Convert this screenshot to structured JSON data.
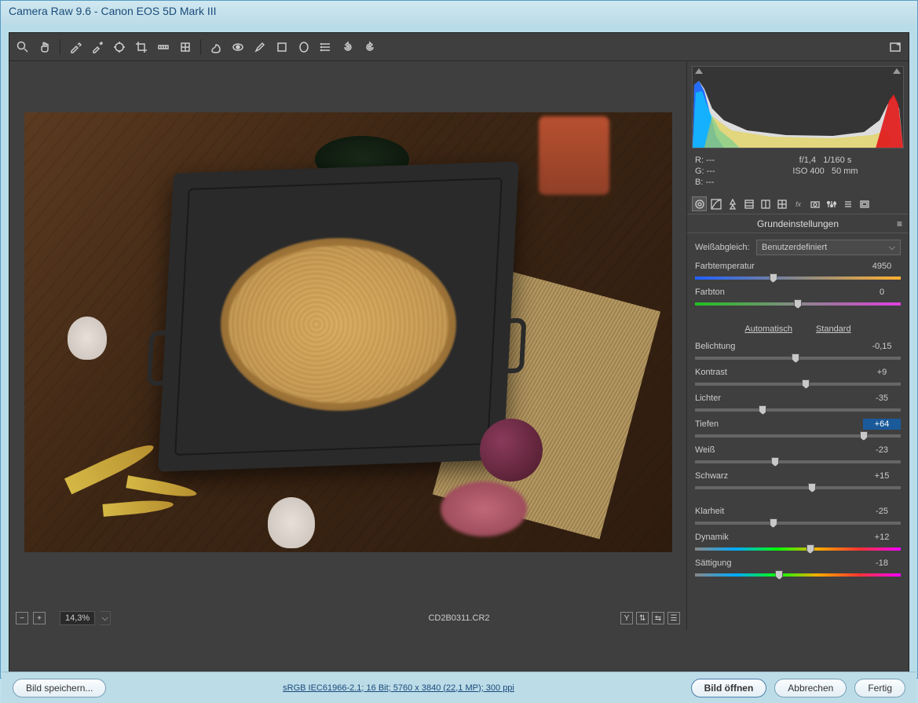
{
  "title": "Camera Raw 9.6 - Canon EOS 5D Mark III",
  "toolbar_icons": [
    "zoom",
    "hand",
    "eyedropper",
    "color-sampler",
    "target-adjust",
    "crop",
    "straighten",
    "transform",
    "spot-removal",
    "redeye",
    "brush",
    "grad-filter",
    "radial-filter",
    "list",
    "rotate-ccw",
    "rotate-cw"
  ],
  "camera": {
    "r": "R:   ---",
    "g": "G:   ---",
    "b": "B:   ---",
    "aperture": "f/1,4",
    "shutter": "1/160 s",
    "iso": "ISO 400",
    "focal": "50 mm"
  },
  "panel": {
    "tabs": [
      "basic",
      "curve",
      "detail",
      "hsl",
      "split",
      "lens",
      "fx",
      "camera",
      "adjust",
      "presets",
      "snapshots"
    ],
    "title": "Grundeinstellungen",
    "wb_label": "Weißabgleich:",
    "wb_value": "Benutzerdefiniert",
    "auto": "Automatisch",
    "default": "Standard",
    "sliders": [
      {
        "label": "Farbtemperatur",
        "value": "4950",
        "pos": 38,
        "grad": "linear-gradient(90deg,#2060ff,#888,#ffb030)"
      },
      {
        "label": "Farbton",
        "value": "0",
        "pos": 50,
        "grad": "linear-gradient(90deg,#20c020,#888,#e040e0)"
      }
    ],
    "exposure_sliders": [
      {
        "label": "Belichtung",
        "value": "-0,15",
        "pos": 49
      },
      {
        "label": "Kontrast",
        "value": "+9",
        "pos": 54
      },
      {
        "label": "Lichter",
        "value": "-35",
        "pos": 33
      },
      {
        "label": "Tiefen",
        "value": "+64",
        "pos": 82,
        "selected": true
      },
      {
        "label": "Weiß",
        "value": "-23",
        "pos": 39
      },
      {
        "label": "Schwarz",
        "value": "+15",
        "pos": 57
      }
    ],
    "presence_sliders": [
      {
        "label": "Klarheit",
        "value": "-25",
        "pos": 38
      },
      {
        "label": "Dynamik",
        "value": "+12",
        "pos": 56,
        "grad": "linear-gradient(90deg,#888,#0af,#0f0,#fa0,#f33,#f0f)"
      },
      {
        "label": "Sättigung",
        "value": "-18",
        "pos": 41,
        "grad": "linear-gradient(90deg,#888,#0af,#0f0,#fa0,#f33,#f0f)"
      }
    ]
  },
  "left_status": {
    "zoom": "14,3%",
    "filename": "CD2B0311.CR2"
  },
  "footer": {
    "save": "Bild speichern...",
    "meta": "sRGB IEC61966-2.1; 16 Bit; 5760 x 3840 (22,1 MP); 300 ppi",
    "open": "Bild öffnen",
    "cancel": "Abbrechen",
    "done": "Fertig"
  }
}
